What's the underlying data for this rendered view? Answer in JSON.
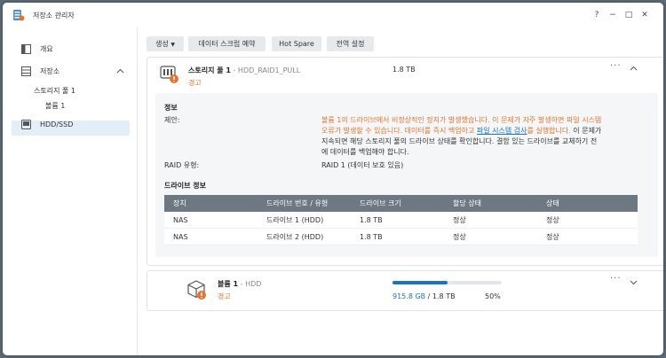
{
  "window": {
    "title": "저장소 관리자",
    "help": "?",
    "minimize": "−",
    "maximize": "□",
    "close": "✕"
  },
  "sidebar": {
    "overview": "개요",
    "storage": "저장소",
    "pool": "스토리지 풀 1",
    "volume": "볼륨 1",
    "hdd": "HDD/SSD"
  },
  "toolbar": {
    "create": "생성",
    "scrub": "데이터 스크럽 예약",
    "hotspare": "Hot Spare",
    "global": "전역 설정"
  },
  "pool": {
    "name": "스토리지 풀 1",
    "sep": " - ",
    "raid": "HDD_RAID1_PULL",
    "status": "경고",
    "size": "1.8 TB",
    "info_title": "정보",
    "suggestion_label": "제안:",
    "suggestion_1": "볼륨 1의 드라이브에서 비정상적인 정지가 발생했습니다. 이 문제가 자주 발생하면 파일 시스템",
    "suggestion_2a": "오류가 발생할 수 있습니다. 데이터를 즉시 백업하고 ",
    "suggestion_link": "파일 시스템 검사",
    "suggestion_2b": "를 실행합니다.",
    "suggestion_2c": " 이 문제가",
    "suggestion_3": "지속되면 해당 스토리지 풀의 드라이브 상태를 확인합니다. 결함 있는 드라이브를 교체하기 전",
    "suggestion_4": "에 데이터를 백업해야 합니다.",
    "raid_label": "RAID 유형:",
    "raid_value": "RAID 1 (데이터 보호 있음)",
    "drive_info_title": "드라이브 정보"
  },
  "drives": {
    "headers": [
      "장치",
      "드라이브 번호 / 유형",
      "드라이브 크기",
      "할당 상태",
      "상태"
    ],
    "rows": [
      [
        "NAS",
        "드라이브 1 (HDD)",
        "1.8 TB",
        "정상",
        "정상"
      ],
      [
        "NAS",
        "드라이브 2 (HDD)",
        "1.8 TB",
        "정상",
        "정상"
      ]
    ]
  },
  "volume": {
    "name": "볼륨 1",
    "sep": " - ",
    "type": "HDD",
    "status": "경고",
    "used": "915.8 GB",
    "of": " / 1.8 TB",
    "percent": "50%",
    "used_fraction": 0.5
  },
  "colors": {
    "accent": "#1a72c9",
    "warning": "#e8742c",
    "ok": "#1c8f2e",
    "header": "#6d7883"
  }
}
